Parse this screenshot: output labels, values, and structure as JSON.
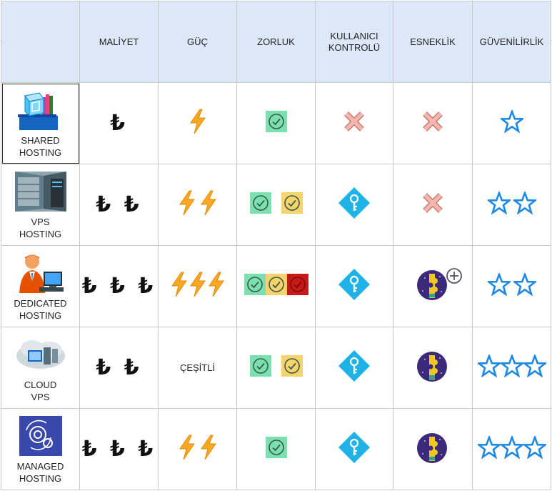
{
  "columns": {
    "corner": "",
    "cost": "MALİYET",
    "power": "GÜÇ",
    "difficulty": "ZORLUK",
    "user_control": "KULLANICI KONTROLÜ",
    "flexibility": "ESNEKLİK",
    "reliability": "GÜVENİLİRLİK"
  },
  "rows": [
    {
      "name": "SHARED\nHOSTING",
      "cost": "₺",
      "power": 1,
      "difficulty": [
        "easy"
      ],
      "user_control": "none",
      "flexibility": "none",
      "reliability": 1,
      "image": "shared-hosting-cube-icon"
    },
    {
      "name": "VPS\nHOSTING",
      "cost": "₺ ₺",
      "power": 2,
      "difficulty": [
        "easy",
        "medium"
      ],
      "user_control": "key",
      "flexibility": "none",
      "reliability": 2,
      "image": "vps-server-room-icon"
    },
    {
      "name": "DEDICATED\nHOSTING",
      "cost": "₺ ₺ ₺",
      "power": 3,
      "difficulty": [
        "easy",
        "medium",
        "hard"
      ],
      "user_control": "key",
      "flexibility": "puzzle-plus",
      "reliability": 2,
      "image": "dedicated-admin-person-icon"
    },
    {
      "name": "CLOUD\nVPS",
      "cost": "₺ ₺",
      "power_text": "ÇEŞİTLİ",
      "difficulty": [
        "easy",
        "medium"
      ],
      "user_control": "key",
      "flexibility": "puzzle",
      "reliability": 3,
      "image": "cloud-servers-icon"
    },
    {
      "name": "MANAGED\nHOSTING",
      "cost": "₺ ₺ ₺",
      "power": 2,
      "difficulty": [
        "easy"
      ],
      "user_control": "key",
      "flexibility": "puzzle",
      "reliability": 3,
      "image": "managed-gears-icon"
    }
  ],
  "colors": {
    "header_bg": "#dce8f8",
    "check_easy": "#7be0b0",
    "check_medium": "#f6d36b",
    "check_hard": "#c81818",
    "bolt": "#f9a825",
    "key_diamond": "#1fb2e6",
    "star": "#1e88e5",
    "x_mark": "#f2b8b0",
    "puzzle_bg": "#3b2a7a"
  }
}
